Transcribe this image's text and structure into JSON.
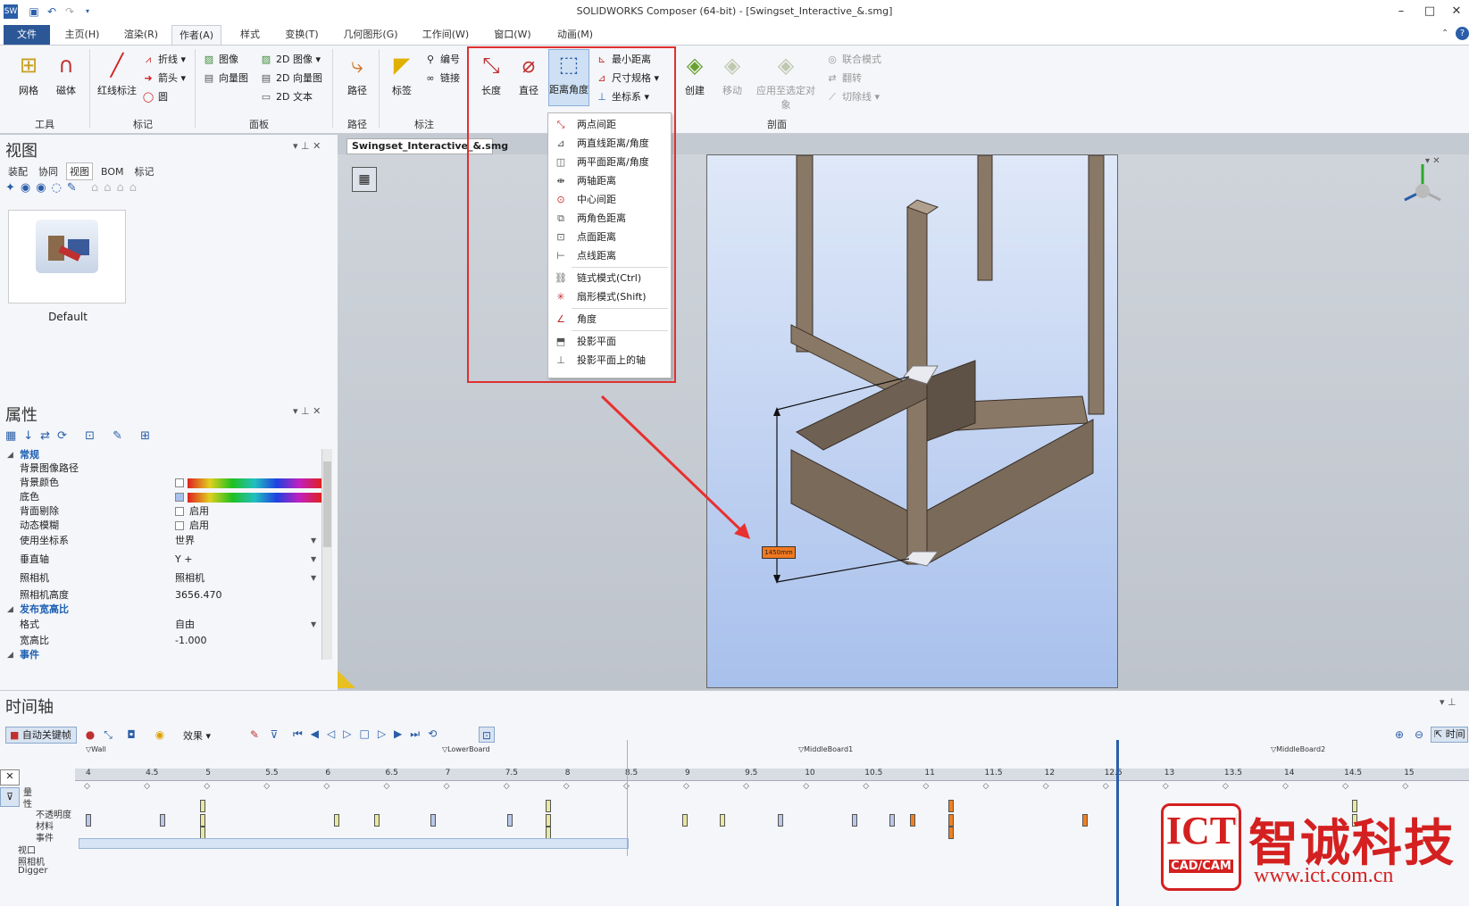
{
  "window": {
    "title": "SOLIDWORKS Composer (64-bit) - [Swingset_Interactive_&.smg]",
    "minimize": "–",
    "restore": "□",
    "close": "✕"
  },
  "ribbon_tabs": [
    "文件",
    "主页(H)",
    "渲染(R)",
    "作者(A)",
    "样式",
    "变换(T)",
    "几何图形(G)",
    "工作间(W)",
    "窗口(W)",
    "动画(M)"
  ],
  "ribbon": {
    "tools": {
      "grid": "网格",
      "magnet": "磁体",
      "group": "工具"
    },
    "markup": {
      "redline": "红线标注",
      "polyline": "折线",
      "arrow": "箭头",
      "circle": "圆",
      "group": "标记"
    },
    "panel": {
      "image": "图像",
      "vector": "向量图",
      "image2d": "2D 图像",
      "vector2d": "2D 向量图",
      "text2d": "2D 文本",
      "group": "面板"
    },
    "path": {
      "path": "路径",
      "group": "路径"
    },
    "annotation": {
      "label": "标签",
      "number": "编号",
      "link": "链接",
      "group": "标注"
    },
    "measure": {
      "length": "长度",
      "diameter": "直径",
      "distance_angle": "距离角度",
      "min_distance": "最小距离",
      "dimension_spec": "尺寸规格",
      "coord_system": "坐标系"
    },
    "section": {
      "create": "创建",
      "move": "移动",
      "apply": "应用至选定对象",
      "joint": "联合模式",
      "flip": "翻转",
      "cutline": "切除线",
      "group": "剖面"
    }
  },
  "dropdown_menu": [
    "两点间距",
    "两直线距离/角度",
    "两平面距离/角度",
    "两轴距离",
    "中心间距",
    "两角色距离",
    "点面距离",
    "点线距离",
    "链式模式(Ctrl)",
    "扇形模式(Shift)",
    "角度",
    "投影平面",
    "投影平面上的轴"
  ],
  "view_pane": {
    "title": "视图",
    "tabs": [
      "装配",
      "协同",
      "视图",
      "BOM",
      "标记"
    ],
    "active_tab": "视图",
    "thumbnail_label": "Default"
  },
  "properties_pane": {
    "title": "属性",
    "sections": {
      "general": "常规",
      "aspect": "发布宽高比",
      "events": "事件"
    },
    "rows": [
      {
        "name": "背景图像路径",
        "value": ""
      },
      {
        "name": "背景颜色",
        "value": ""
      },
      {
        "name": "底色",
        "value": ""
      },
      {
        "name": "背面剔除",
        "value": "启用"
      },
      {
        "name": "动态模糊",
        "value": "启用"
      },
      {
        "name": "使用坐标系",
        "value": "世界"
      },
      {
        "name": "垂直轴",
        "value": "Y +"
      },
      {
        "name": "照相机",
        "value": "照相机"
      },
      {
        "name": "照相机高度",
        "value": "3656.470"
      },
      {
        "name": "格式",
        "value": "自由"
      },
      {
        "name": "宽高比",
        "value": "-1.000"
      }
    ]
  },
  "document_tab": "Swingset_Interactive_&.smg",
  "dimension_label": "1450mm",
  "timeline": {
    "title": "时间轴",
    "autokey": "自动关键帧",
    "effects": "效果",
    "time_mode": "时间",
    "markers": [
      "Wall",
      "LowerBoard",
      "MiddleBoard1",
      "MiddleBoard2"
    ],
    "ticks": [
      "4",
      "4.5",
      "5",
      "5.5",
      "6",
      "6.5",
      "7",
      "7.5",
      "8",
      "8.5",
      "9",
      "9.5",
      "10",
      "10.5",
      "11",
      "11.5",
      "12",
      "12.5",
      "13",
      "13.5",
      "14",
      "14.5",
      "15"
    ],
    "tracks": [
      "量",
      "性",
      "不透明度",
      "材料",
      "事件",
      "视口",
      "照相机",
      "Digger"
    ]
  },
  "watermark": {
    "brand": "ICT",
    "name": "智诚科技",
    "sub": "CAD/CAM",
    "url": "www.ict.com.cn"
  }
}
